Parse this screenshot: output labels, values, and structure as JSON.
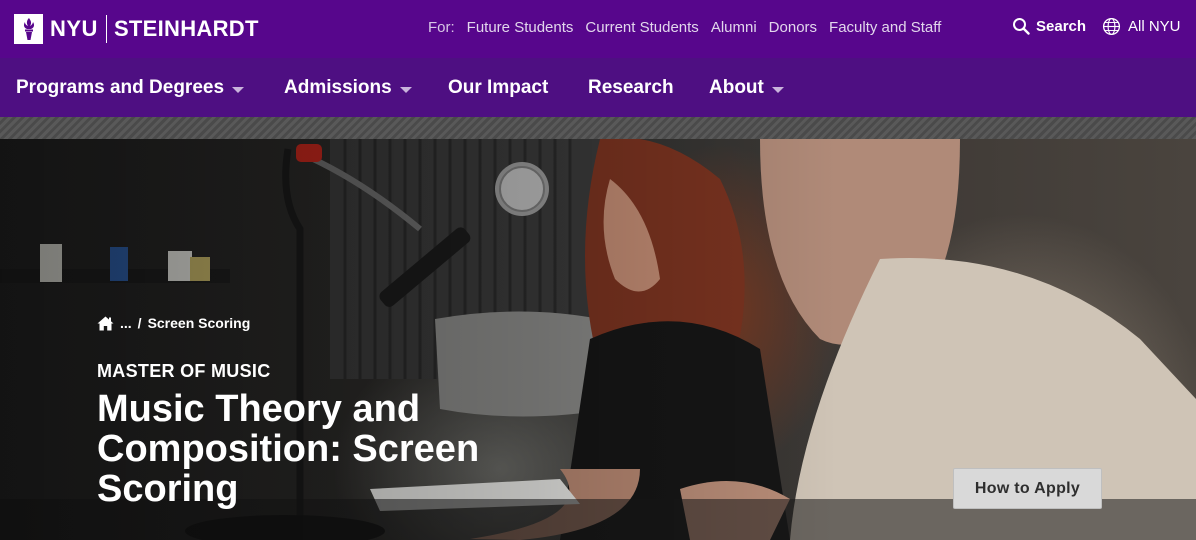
{
  "brand": {
    "university": "NYU",
    "school": "STEINHARDT"
  },
  "utility": {
    "for_label": "For:",
    "audience_links": [
      "Future Students",
      "Current Students",
      "Alumni",
      "Donors",
      "Faculty and Staff"
    ],
    "search_label": "Search",
    "all_nyu_label": "All NYU"
  },
  "main_nav": {
    "items": [
      {
        "label": "Programs and Degrees",
        "has_dropdown": true
      },
      {
        "label": "Admissions",
        "has_dropdown": true
      },
      {
        "label": "Our Impact",
        "has_dropdown": false
      },
      {
        "label": "Research",
        "has_dropdown": false
      },
      {
        "label": "About",
        "has_dropdown": true
      }
    ]
  },
  "breadcrumb": {
    "home_icon": "home-icon",
    "ellipsis": "...",
    "separator": "/",
    "current": "Screen Scoring"
  },
  "hero": {
    "degree": "MASTER OF MUSIC",
    "title": "Music Theory and Composition: Screen Scoring",
    "cta_label": "How to Apply"
  },
  "colors": {
    "brand_purple": "#57068c",
    "nav_purple": "#4e0f82",
    "button_gray": "#d9d9d9"
  }
}
